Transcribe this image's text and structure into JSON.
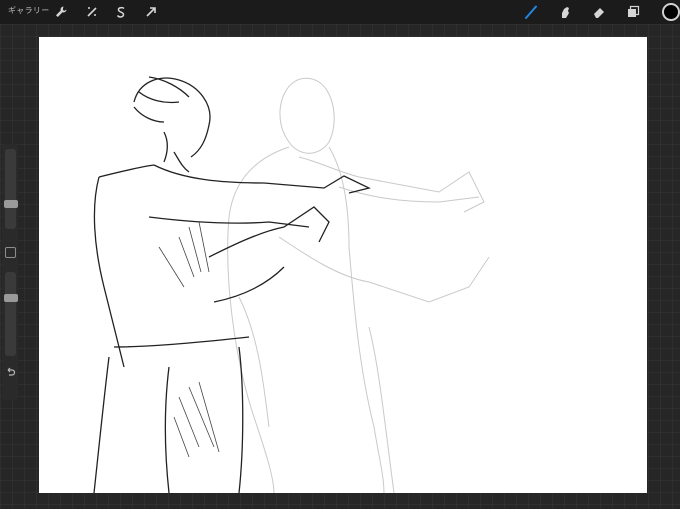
{
  "topbar": {
    "gallery_label": "ギャラリー",
    "left_tools": [
      {
        "icon": "wrench-icon"
      },
      {
        "icon": "adjustments-wand-icon"
      },
      {
        "icon": "selection-s-icon"
      },
      {
        "icon": "transform-arrow-icon"
      }
    ],
    "right_tools": [
      {
        "icon": "brush-icon",
        "active": true
      },
      {
        "icon": "smudge-icon"
      },
      {
        "icon": "eraser-icon"
      },
      {
        "icon": "layers-icon"
      }
    ],
    "color": "#000000"
  },
  "sidebar": {
    "brush_size_level": 0.45,
    "opacity_level": 0.35
  },
  "colors": {
    "accent": "#1e88e5",
    "background": "#262626"
  }
}
